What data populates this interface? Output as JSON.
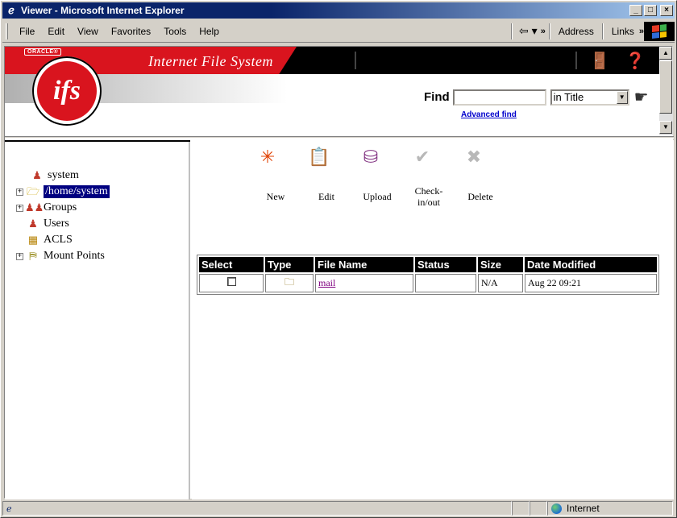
{
  "window": {
    "title": "Viewer - Microsoft Internet Explorer",
    "controls": [
      "_",
      "□",
      "×"
    ]
  },
  "menubar": {
    "items": [
      "File",
      "Edit",
      "View",
      "Favorites",
      "Tools",
      "Help"
    ],
    "address_label": "Address",
    "links_label": "Links",
    "chevron": "»"
  },
  "header": {
    "oracle_tag": "ORACLE®",
    "logo_text": "ifs",
    "app_title": "Internet File System",
    "find_label": "Find",
    "find_value": "",
    "find_scope": "in Title",
    "advanced_find": "Advanced find"
  },
  "tree": {
    "items": [
      {
        "label": "system",
        "icon": "user-icon",
        "expandable": false,
        "selected": false
      },
      {
        "label": "/home/system",
        "icon": "folder-open-icon",
        "expandable": true,
        "selected": true
      },
      {
        "label": "Groups",
        "icon": "groups-icon",
        "expandable": true,
        "selected": false
      },
      {
        "label": "Users",
        "icon": "users-icon",
        "expandable": false,
        "selected": false
      },
      {
        "label": "ACLS",
        "icon": "acl-icon",
        "expandable": false,
        "selected": false
      },
      {
        "label": "Mount Points",
        "icon": "mount-points-icon",
        "expandable": true,
        "selected": false
      }
    ]
  },
  "toolbar": {
    "new_label": "New",
    "edit_label": "Edit",
    "upload_label": "Upload",
    "checkin_label_1": "Check-",
    "checkin_label_2": "in/out",
    "delete_label": "Delete"
  },
  "files_table": {
    "columns": [
      "Select",
      "Type",
      "File Name",
      "Status",
      "Size",
      "Date Modified"
    ],
    "rows": [
      {
        "select": false,
        "type": "mail-folder-icon",
        "file_name": "mail",
        "status": "",
        "size": "N/A",
        "date_modified": "Aug 22 09:21"
      }
    ]
  },
  "statusbar": {
    "zone": "Internet"
  },
  "colors": {
    "title_bar": "#0a246a",
    "banner_red": "#d9141e",
    "selection": "#000080",
    "link_visited": "#800080"
  }
}
